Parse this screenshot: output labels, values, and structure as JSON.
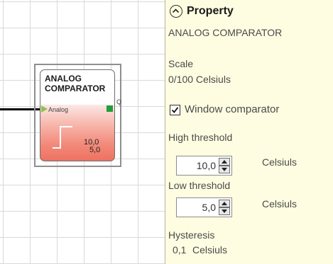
{
  "block": {
    "title_line1": "ANALOG",
    "title_line2": "COMPARATOR",
    "input_label": "Analog",
    "output_label": "Q",
    "value_high": "10,0",
    "value_low": "5,0",
    "colors": {
      "fill_bottom": "#ee7161",
      "input_pin": "#8bc34a",
      "output_pin": "#1f9e3a"
    }
  },
  "panel": {
    "title": "Property",
    "block_name": "ANALOG COMPARATOR",
    "scale_label": "Scale",
    "scale_value": "0/100 Celsiuls",
    "window_comparator_label": "Window comparator",
    "window_comparator_checked": true,
    "high_threshold_label": "High threshold",
    "high_threshold_value": "10,0",
    "high_threshold_unit": "Celsiuls",
    "low_threshold_label": "Low threshold",
    "low_threshold_value": "5,0",
    "low_threshold_unit": "Celsiuls",
    "hysteresis_label": "Hysteresis",
    "hysteresis_value": "0,1",
    "hysteresis_unit": "Celsiuls",
    "background": "#fffde1"
  },
  "icons": {
    "collapse": "chevron-up-in-circle",
    "checkbox": "checkmark",
    "spinner": "up-down-arrows"
  }
}
